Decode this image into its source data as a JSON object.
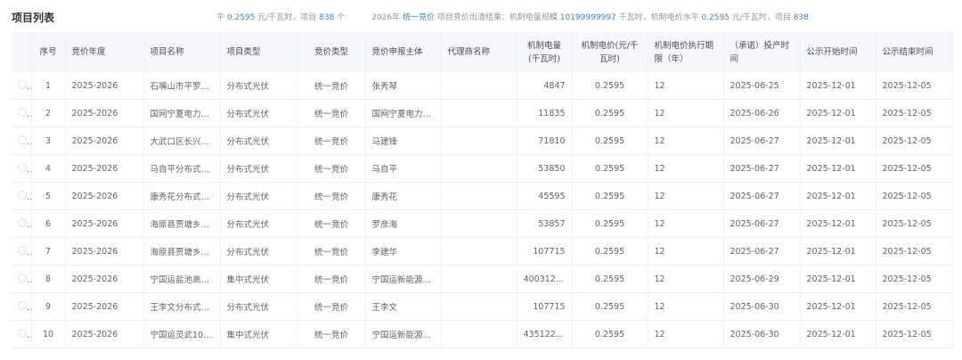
{
  "title": "项目列表",
  "summary": {
    "p1": "平 ",
    "v1": "0.2595",
    "p2": " 元/千瓦时，项目 ",
    "v2": "838",
    "p3": " 个",
    "p4": "2026年 ",
    "v3": "统一竞价",
    "p5": " 项目竞价出清结果：机制电量规模 ",
    "v4": "10199999997",
    "p6": " 千瓦时，机制电价水平 ",
    "v5": "0.2595",
    "p7": " 元/千瓦时，项目 ",
    "v6": "838"
  },
  "columns": [
    "",
    "序号",
    "竞价年度",
    "项目名称",
    "项目类型",
    "竞价类型",
    "竞价申报主体",
    "代理商名称",
    "机制电量(千瓦时)",
    "机制电价(元/千瓦时)",
    "机制电价执行期限（年）",
    "（承诺）投产时间",
    "公示开始时间",
    "公示结束时间"
  ],
  "rows": [
    [
      "1",
      "2025-2026",
      "石嘴山市平罗…",
      "分布式光伏",
      "统一竞价",
      "张秀琴",
      "",
      "4847",
      "0.2595",
      "12",
      "2025-06-25",
      "2025-12-01",
      "2025-12-05"
    ],
    [
      "2",
      "2025-2026",
      "国网宁夏电力…",
      "分布式光伏",
      "统一竞价",
      "国网宁夏电力…",
      "",
      "11835",
      "0.2595",
      "12",
      "2025-06-26",
      "2025-12-01",
      "2025-12-05"
    ],
    [
      "3",
      "2025-2026",
      "大武口区长兴…",
      "分布式光伏",
      "统一竞价",
      "马建锋",
      "",
      "71810",
      "0.2595",
      "12",
      "2025-06-27",
      "2025-12-01",
      "2025-12-05"
    ],
    [
      "4",
      "2025-2026",
      "马自平分布式…",
      "分布式光伏",
      "统一竞价",
      "马自平",
      "",
      "53850",
      "0.2595",
      "12",
      "2025-06-27",
      "2025-12-01",
      "2025-12-05"
    ],
    [
      "5",
      "2025-2026",
      "康秀花分布式…",
      "分布式光伏",
      "统一竞价",
      "康秀花",
      "",
      "45595",
      "0.2595",
      "12",
      "2025-06-27",
      "2025-12-01",
      "2025-12-05"
    ],
    [
      "6",
      "2025-2026",
      "海原县贾塘乡…",
      "分布式光伏",
      "统一竞价",
      "罗彦海",
      "",
      "53857",
      "0.2595",
      "12",
      "2025-06-27",
      "2025-12-01",
      "2025-12-05"
    ],
    [
      "7",
      "2025-2026",
      "海原县贾塘乡…",
      "分布式光伏",
      "统一竞价",
      "李建华",
      "",
      "107715",
      "0.2595",
      "12",
      "2025-06-27",
      "2025-12-01",
      "2025-12-05"
    ],
    [
      "8",
      "2025-2026",
      "宁国运盐池高…",
      "集中式光伏",
      "统一竞价",
      "宁国运新能源(…",
      "",
      "400312420",
      "0.2595",
      "12",
      "2025-06-29",
      "2025-12-01",
      "2025-12-05"
    ],
    [
      "9",
      "2025-2026",
      "王李文分布式…",
      "分布式光伏",
      "统一竞价",
      "王李文",
      "",
      "107715",
      "0.2595",
      "12",
      "2025-06-30",
      "2025-12-01",
      "2025-12-05"
    ],
    [
      "10",
      "2025-2026",
      "宁国运灵武100…",
      "集中式光伏",
      "统一竞价",
      "宁国运新能源…",
      "",
      "435122196",
      "0.2595",
      "12",
      "2025-06-30",
      "2025-12-01",
      "2025-12-05"
    ]
  ]
}
